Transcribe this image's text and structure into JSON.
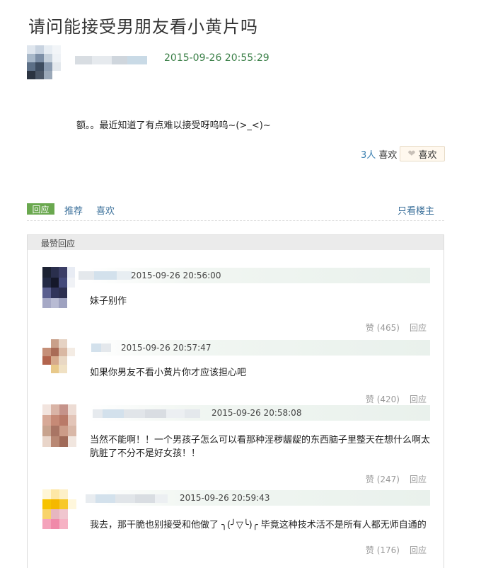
{
  "post": {
    "title": "请问能接受男朋友看小黄片吗",
    "timestamp": "2015-09-26 20:55:29",
    "body": "额。。最近知道了有点难以接受呀呜呜~(>_<)~",
    "like_count_num": "3人",
    "like_count_suffix": "喜欢",
    "like_button": "喜欢"
  },
  "actions": {
    "reply": "回应",
    "recommend": "推荐",
    "like": "喜欢",
    "only_op": "只看楼主"
  },
  "comments_header": "最赞回应",
  "comments": [
    {
      "time": "2015-09-26 20:56:00",
      "text": "妹子别作",
      "likes": "赞 (465)",
      "reply": "回应"
    },
    {
      "time": "2015-09-26 20:57:47",
      "text": "如果你男友不看小黄片你才应该担心吧",
      "likes": "赞 (420)",
      "reply": "回应"
    },
    {
      "time": "2015-09-26 20:58:08",
      "text": "当然不能啊！！一个男孩子怎么可以看那种淫秽龌龊的东西脑子里整天在想什么啊太肮脏了不分不是好女孩！！",
      "likes": "赞 (247)",
      "reply": "回应"
    },
    {
      "time": "2015-09-26 20:59:43",
      "text": "我去，那干脆也别接受和他做了 ╮(╯▽╰)╭ 毕竟这种技术活不是所有人都无师自通的",
      "likes": "赞 (176)",
      "reply": "回应"
    }
  ],
  "colors": {
    "accent_green": "#6aa84f",
    "link_blue": "#3a6f9a",
    "timestamp_green": "#3a7f47"
  }
}
